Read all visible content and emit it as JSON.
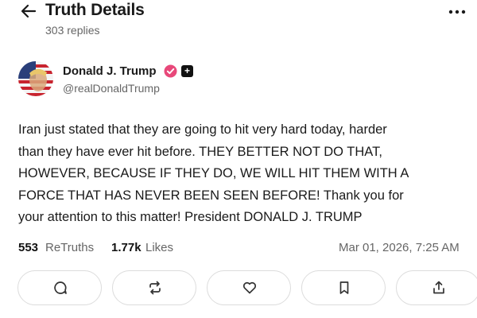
{
  "header": {
    "title": "Truth Details",
    "replies": "303 replies",
    "back_icon": "arrow-left-icon",
    "more_icon": "more-dots-icon"
  },
  "post": {
    "author_name": "Donald J. Trump",
    "handle": "@realDonaldTrump",
    "verified_icon": "verified-badge-icon",
    "text": "Iran just stated that they are going to hit very hard today, harder\nthan they have ever hit before. THEY BETTER NOT DO THAT,\nHOWEVER, BECAUSE IF THEY DO, WE WILL HIT THEM WITH A\nFORCE THAT HAS NEVER BEEN SEEN BEFORE! Thank you for\nyour attention to this matter! President DONALD J. TRUMP",
    "retruths_count": "553",
    "retruths_label": "ReTruths",
    "likes_count": "1.77k",
    "likes_label": "Likes",
    "timestamp": "Mar 01, 2026, 7:25 AM"
  },
  "actions": [
    {
      "name": "reply",
      "icon": "comment-icon"
    },
    {
      "name": "retruth",
      "icon": "repost-icon"
    },
    {
      "name": "like",
      "icon": "heart-icon"
    },
    {
      "name": "bookmark",
      "icon": "bookmark-icon"
    },
    {
      "name": "share",
      "icon": "share-icon"
    }
  ],
  "colors": {
    "text": "#1a1a1a",
    "muted": "#666666",
    "verified": "#e8487a",
    "border": "#dcdcdc"
  }
}
